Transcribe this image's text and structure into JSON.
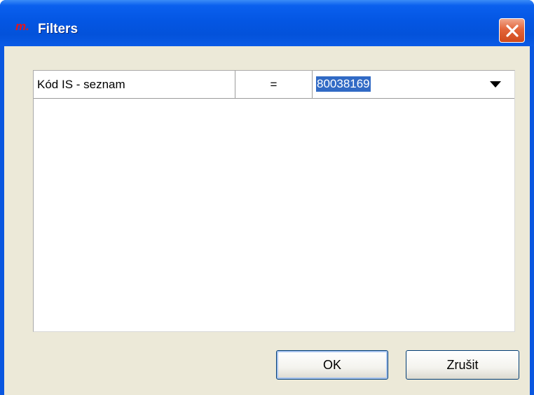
{
  "window": {
    "title": "Filters",
    "logo_text": "m."
  },
  "filter_grid": {
    "rows": [
      {
        "field": "Kód IS - seznam",
        "operator": "=",
        "value": "80038169"
      }
    ]
  },
  "buttons": {
    "ok_label": "OK",
    "cancel_label": "Zrušit"
  },
  "icons": {
    "close": "close-icon",
    "dropdown": "chevron-down-icon",
    "logo": "app-logo"
  },
  "colors": {
    "titlebar": "#0456e3",
    "selection": "#316ac5",
    "close_button": "#e3653a",
    "dialog_background": "#ece9d8"
  }
}
